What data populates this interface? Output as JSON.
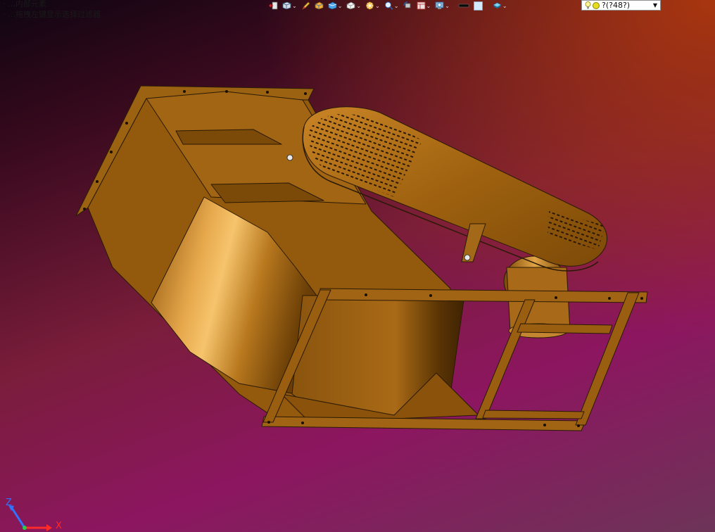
{
  "hints": {
    "line1": "· …内部元素",
    "line2": "· …拖拽左键显示选择过滤器"
  },
  "toolbar": {
    "buttons": [
      {
        "id": "previous-view",
        "icon": "previous-view-icon",
        "dropdown": false
      },
      {
        "id": "view-orientation",
        "icon": "view-orientation-icon",
        "dropdown": true
      },
      {
        "id": "edit-appearance",
        "icon": "edit-appearance-icon",
        "dropdown": false
      },
      {
        "id": "display-style",
        "icon": "display-style-icon",
        "dropdown": false
      },
      {
        "id": "section-view",
        "icon": "section-view-icon",
        "dropdown": true
      },
      {
        "id": "standard-views",
        "icon": "standard-views-icon",
        "dropdown": true
      },
      {
        "id": "hide-show-items",
        "icon": "hide-show-items-icon",
        "dropdown": true
      },
      {
        "id": "zoom",
        "icon": "zoom-icon",
        "dropdown": true
      },
      {
        "id": "rotate-view",
        "icon": "rotate-view-icon",
        "dropdown": false
      },
      {
        "id": "display-pane",
        "icon": "display-pane-icon",
        "dropdown": true
      },
      {
        "id": "apply-scene",
        "icon": "apply-scene-icon",
        "dropdown": true
      },
      {
        "id": "line-color",
        "icon": "line-color-icon",
        "dropdown": false
      },
      {
        "id": "background-color",
        "icon": "background-color-icon",
        "dropdown": false
      },
      {
        "id": "layers",
        "icon": "layers-icon",
        "dropdown": true
      }
    ],
    "colors": {
      "accent": "#f0b040",
      "blue": "#2f86d6",
      "gray": "#c8c8c8"
    }
  },
  "light_combo": {
    "value": "?(?48?)"
  },
  "triad": {
    "z_label": "Z",
    "x_label": "X",
    "z_color": "#2f73ff",
    "x_color": "#ff2a2a"
  },
  "model": {
    "part_color": "#9a6211",
    "highlight_color": "#f3bb5b",
    "edge_color": "#2a1a05"
  }
}
